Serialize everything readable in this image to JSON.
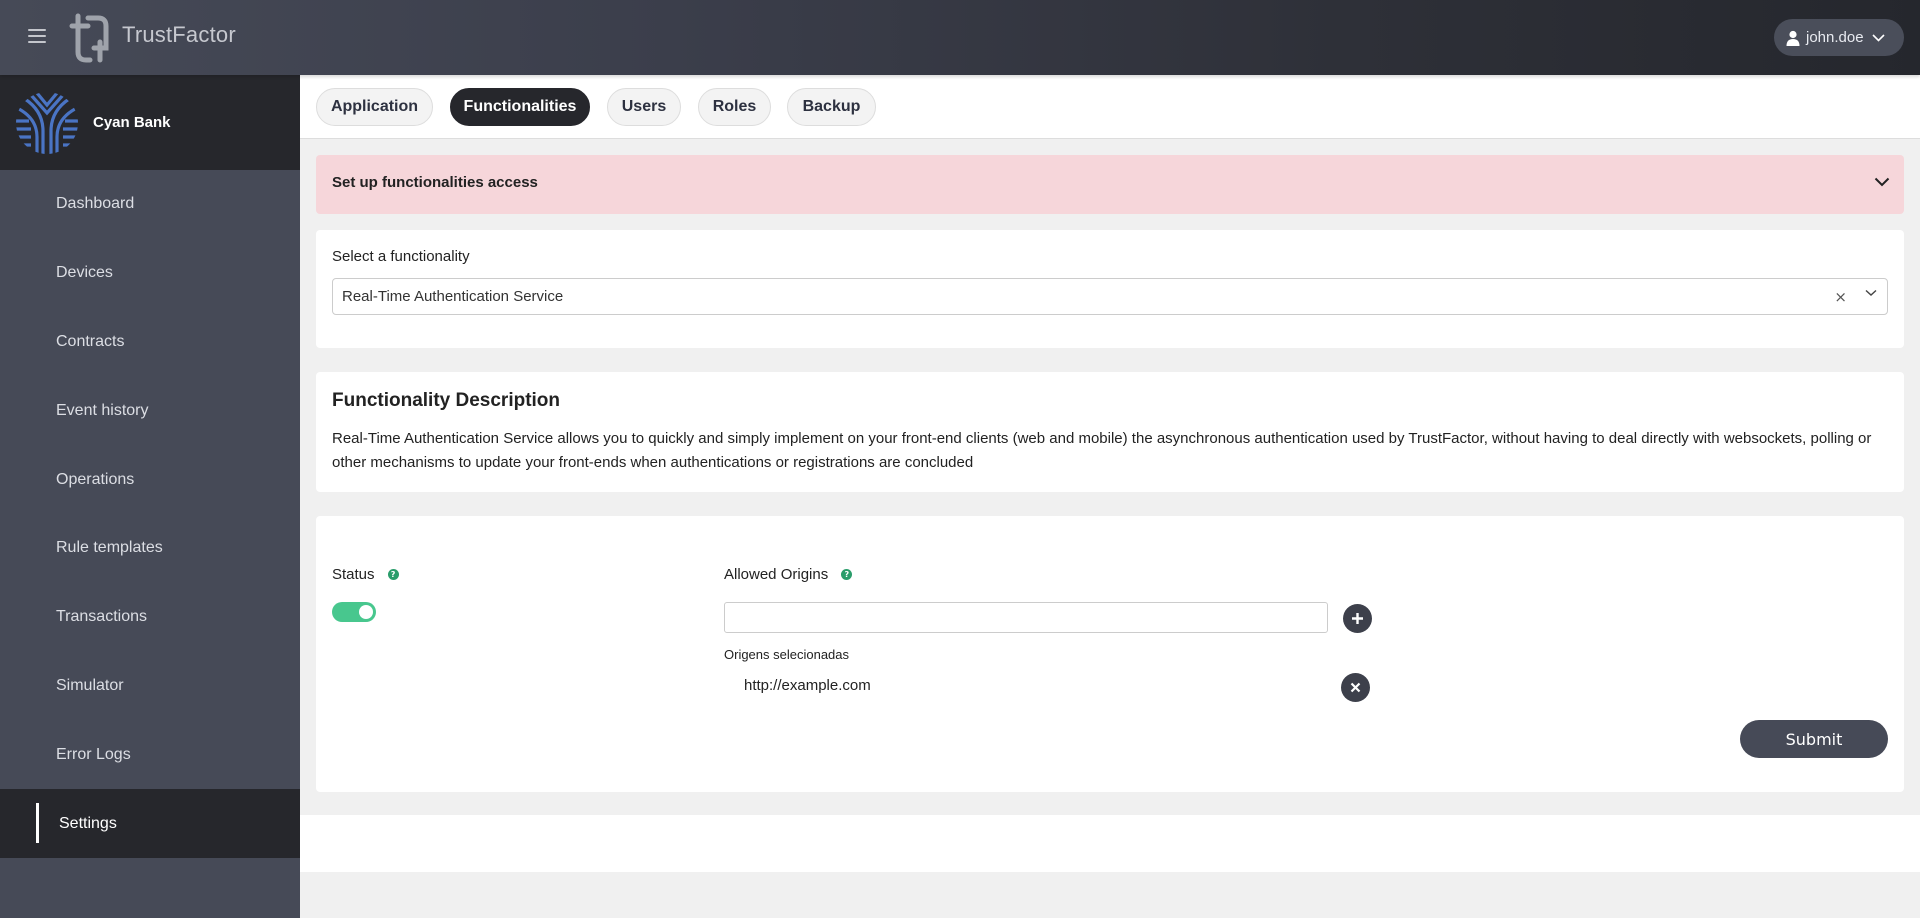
{
  "app": {
    "brand": "TrustFactor",
    "user": "john.doe"
  },
  "sidebar": {
    "org_name": "Cyan Bank",
    "items": [
      {
        "label": "Dashboard",
        "active": false
      },
      {
        "label": "Devices",
        "active": false
      },
      {
        "label": "Contracts",
        "active": false
      },
      {
        "label": "Event history",
        "active": false
      },
      {
        "label": "Operations",
        "active": false
      },
      {
        "label": "Rule templates",
        "active": false
      },
      {
        "label": "Transactions",
        "active": false
      },
      {
        "label": "Simulator",
        "active": false
      },
      {
        "label": "Error Logs",
        "active": false
      },
      {
        "label": "Settings",
        "active": true
      }
    ]
  },
  "tabs": [
    {
      "label": "Application",
      "active": false
    },
    {
      "label": "Functionalities",
      "active": true
    },
    {
      "label": "Users",
      "active": false
    },
    {
      "label": "Roles",
      "active": false
    },
    {
      "label": "Backup",
      "active": false
    }
  ],
  "accordion": {
    "title": "Set up functionalities access",
    "expanded": false
  },
  "functionality_select": {
    "label": "Select a functionality",
    "value": "Real-Time Authentication Service",
    "clear_symbol": "×"
  },
  "description": {
    "title": "Functionality Description",
    "text": "Real-Time Authentication Service allows you to quickly and simply implement on your front-end clients (web and mobile) the asynchronous authentication used by TrustFactor, without having to deal directly with websockets, polling or other mechanisms to update your front-ends when authentications or registrations are concluded"
  },
  "config": {
    "status_label": "Status",
    "status_enabled": true,
    "help_symbol": "?",
    "origins_label": "Allowed Origins",
    "origin_input_value": "",
    "selected_label": "Origens selecionadas",
    "selected_origins": [
      "http://example.com"
    ],
    "submit_label": "Submit"
  },
  "colors": {
    "accent_dark": "#26272c",
    "sidebar": "#464a57",
    "alert_bg": "#f6d6da",
    "toggle_on": "#48c78e",
    "help_green": "#2a9d6b"
  }
}
